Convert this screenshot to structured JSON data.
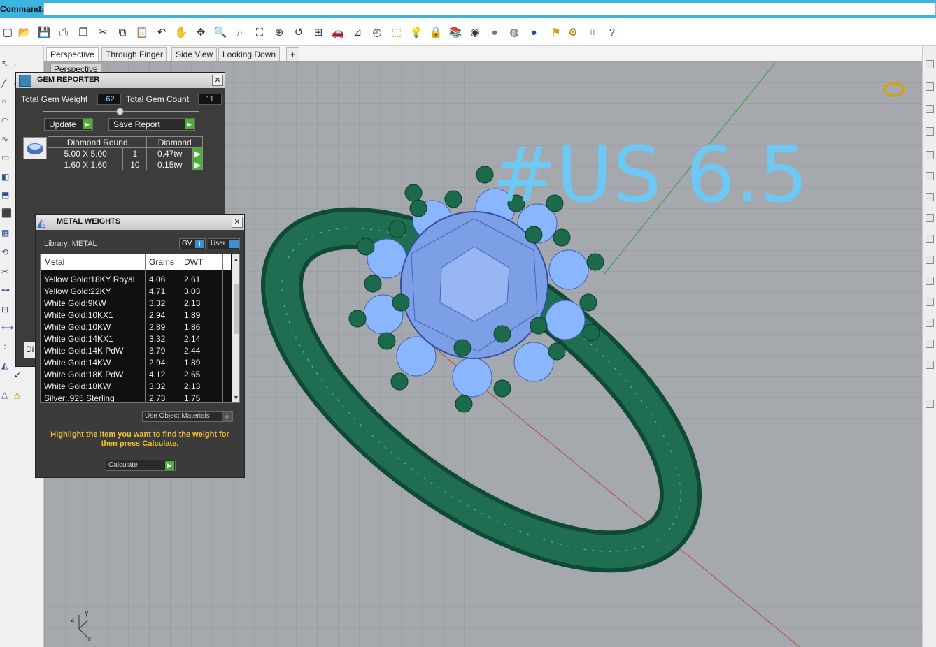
{
  "command_bar": {
    "label": "Command:",
    "value": ""
  },
  "view_tabs": [
    {
      "label": "Perspective",
      "active": true
    },
    {
      "label": "Through Finger",
      "active": false
    },
    {
      "label": "Side View",
      "active": false
    },
    {
      "label": "Looking Down",
      "active": false
    },
    {
      "label": "+",
      "active": false
    }
  ],
  "viewport": {
    "label": "Perspective",
    "annotation": "#US 6.5",
    "axis_labels": {
      "z": "z",
      "y": "y",
      "x": "x"
    }
  },
  "gem_reporter": {
    "title": "GEM REPORTER",
    "total_weight_label": "Total Gem Weight",
    "total_weight_value": ".62",
    "total_count_label": "Total Gem Count",
    "total_count_value": "11",
    "update_label": "Update",
    "save_report_label": "Save Report",
    "table_headers": [
      "Diamond Round",
      "Diamond"
    ],
    "rows": [
      {
        "size": "5.00 X 5.00",
        "count": "1",
        "weight": "0.47tw"
      },
      {
        "size": "1.60 X 1.60",
        "count": "10",
        "weight": "0.15tw"
      }
    ],
    "cut_off_label": "Di"
  },
  "metal_weights": {
    "title": "METAL WEIGHTS",
    "library_label": "Library: METAL",
    "gv_label": "GV",
    "user_label": "User",
    "headers": [
      "Metal",
      "Grams",
      "DWT"
    ],
    "rows": [
      {
        "metal": "Yellow Gold:18KY Royal",
        "grams": "4.06",
        "dwt": "2.61"
      },
      {
        "metal": "Yellow Gold:22KY",
        "grams": "4.71",
        "dwt": "3.03"
      },
      {
        "metal": "White Gold:9KW",
        "grams": "3.32",
        "dwt": "2.13"
      },
      {
        "metal": "White Gold:10KX1",
        "grams": "2.94",
        "dwt": "1.89"
      },
      {
        "metal": "White Gold:10KW",
        "grams": "2.89",
        "dwt": "1.86"
      },
      {
        "metal": "White Gold:14KX1",
        "grams": "3.32",
        "dwt": "2.14"
      },
      {
        "metal": "White Gold:14K PdW",
        "grams": "3.79",
        "dwt": "2.44"
      },
      {
        "metal": "White Gold:14KW",
        "grams": "2.94",
        "dwt": "1.89"
      },
      {
        "metal": "White Gold:18K PdW",
        "grams": "4.12",
        "dwt": "2.65"
      },
      {
        "metal": "White Gold:18KW",
        "grams": "3.32",
        "dwt": "2.13"
      },
      {
        "metal": "Silver:.925 Sterling",
        "grams": "2.73",
        "dwt": "1.75"
      }
    ],
    "use_object_materials_label": "Use Object Materials",
    "hint": "Highlight the item you want to find the weight for then press Calculate.",
    "calculate_label": "Calculate"
  },
  "colors": {
    "accent": "#3cb4e0",
    "ring_green": "#1f6e52",
    "gem_blue": "#8ab6ff",
    "annotation_blue": "#6ec8f4",
    "hint_yellow": "#f2c230"
  }
}
